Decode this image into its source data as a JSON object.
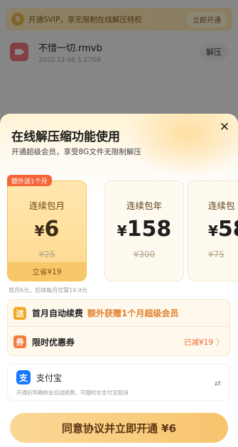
{
  "background": {
    "vip_banner": {
      "text": "开通SVIP，享无限制在线解压特权",
      "button": "立即开通",
      "coin_icon": "coin-icon"
    },
    "file": {
      "name": "不惜一切.rmvb",
      "date": "2022-12-06",
      "size": "1.27GB",
      "action": "解压",
      "icon": "video-file-icon"
    }
  },
  "sheet": {
    "title": "在线解压缩功能使用",
    "subtitle": "开通超级会员，享受8G文件无限制解压",
    "close_icon": "close-icon",
    "promo_tag": "额外送1个月",
    "plans": [
      {
        "name": "连续包月",
        "currency": "¥",
        "price": "6",
        "original": "¥25",
        "footer": "立省¥19",
        "selected": true
      },
      {
        "name": "连续包年",
        "currency": "¥",
        "price": "158",
        "original": "¥300",
        "selected": false
      },
      {
        "name": "连续包",
        "currency": "¥",
        "price": "58",
        "original": "¥75",
        "selected": false
      }
    ],
    "renew_note": "首月6元，后续每月仅需19.9元",
    "perks": [
      {
        "icon": "送",
        "label": "首月自动续费",
        "highlight": "额外获赠1个月超级会员"
      },
      {
        "icon": "券",
        "label": "限时优惠券",
        "value": "已减¥19",
        "chevron": "〉"
      }
    ],
    "payment": {
      "name": "支付宝",
      "icon_glyph": "支",
      "note": "开通后到期前会自动续费，可随时在支付宝取消",
      "swap_icon": "⇄"
    },
    "cta": "同意协议并立即开通 ¥6"
  },
  "colors": {
    "accent": "#f7c46d",
    "promo": "#f46537",
    "alipay": "#1677ff"
  }
}
